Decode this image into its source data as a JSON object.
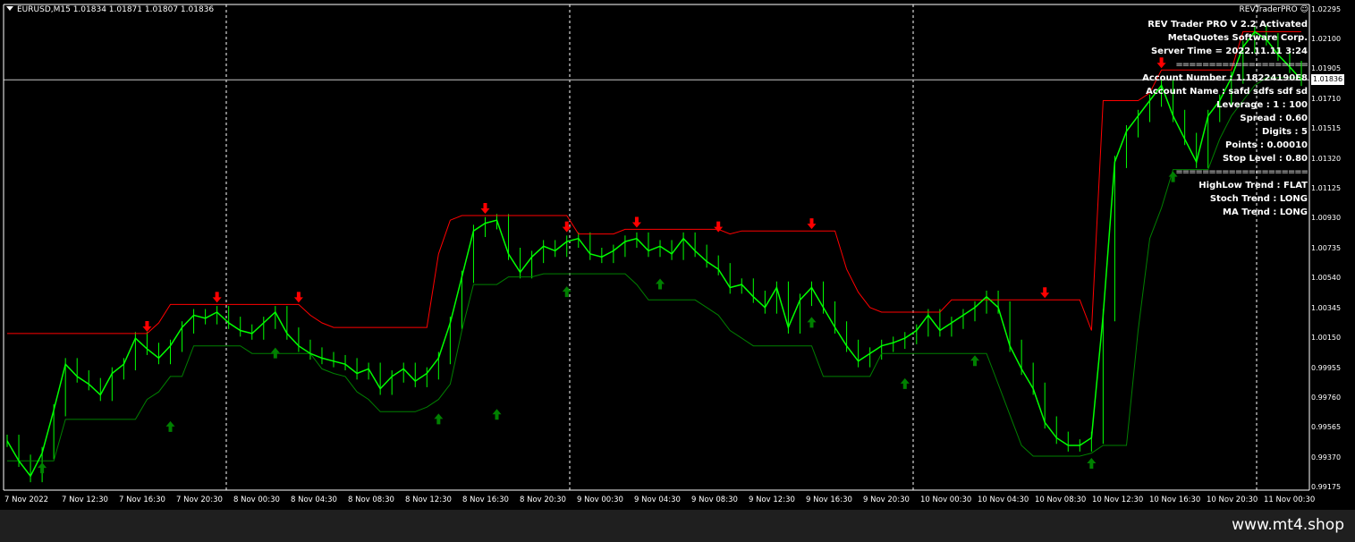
{
  "header": {
    "symbol_line": "EURUSD,M15  1.01834 1.01871 1.01807 1.01836"
  },
  "brand": {
    "label": "REVTraderPRO"
  },
  "info_panel": {
    "lines": [
      "REV Trader PRO V 2.2  Activated",
      "MetaQuotes Software Corp.",
      "Server Time = 2022.11.11 3:24",
      "====================",
      "Account Number : 1.18224190E8",
      "Account Name : safd   sdfs sdf  sd",
      "Leverage : 1 : 100",
      "Spread : 0.60",
      "Digits : 5",
      "Points : 0.00010",
      "Stop Level : 0.80",
      "====================",
      "HighLow Trend : FLAT",
      "Stoch Trend : LONG",
      "MA Trend : LONG"
    ]
  },
  "current_price": "1.01836",
  "footer": {
    "watermark": "www.mt4.shop"
  },
  "colors": {
    "candle": "#00ff00",
    "upper_band": "#ff0000",
    "lower_band": "#008000",
    "sell_arrow": "#ff0000",
    "buy_arrow": "#008000",
    "grid": "#ffffff",
    "background": "#000000"
  },
  "chart_data": {
    "type": "line",
    "symbol": "EURUSD",
    "timeframe": "M15",
    "ylim": [
      0.9917,
      1.0231
    ],
    "x_ticks": [
      "7 Nov 2022",
      "7 Nov 12:30",
      "7 Nov 16:30",
      "7 Nov 20:30",
      "8 Nov 00:30",
      "8 Nov 04:30",
      "8 Nov 08:30",
      "8 Nov 12:30",
      "8 Nov 16:30",
      "8 Nov 20:30",
      "9 Nov 00:30",
      "9 Nov 04:30",
      "9 Nov 08:30",
      "9 Nov 12:30",
      "9 Nov 16:30",
      "9 Nov 20:30",
      "10 Nov 00:30",
      "10 Nov 04:30",
      "10 Nov 08:30",
      "10 Nov 12:30",
      "10 Nov 16:30",
      "10 Nov 20:30",
      "11 Nov 00:30"
    ],
    "y_ticks": [
      "1.02295",
      "1.02100",
      "1.01905",
      "1.01710",
      "1.01515",
      "1.01320",
      "1.01125",
      "1.00930",
      "1.00735",
      "1.00540",
      "1.00345",
      "1.00150",
      "0.99955",
      "0.99760",
      "0.99565",
      "0.99370",
      "0.99175"
    ],
    "y_tick_values": [
      1.02295,
      1.021,
      1.01905,
      1.0171,
      1.01515,
      1.0132,
      1.01125,
      1.0093,
      1.00735,
      1.0054,
      1.00345,
      1.0015,
      0.99955,
      0.9976,
      0.99565,
      0.9937,
      0.99175
    ],
    "current_price_value": 1.01836,
    "day_separators": [
      "7 Nov 22:00",
      "8 Nov 22:00",
      "9 Nov 22:00",
      "10 Nov 22:00"
    ],
    "series": [
      {
        "name": "",
        "role": "price",
        "values": [
          0.9948,
          0.9935,
          0.9925,
          0.994,
          0.9968,
          0.9998,
          0.999,
          0.9985,
          0.9978,
          0.9992,
          0.9998,
          1.0015,
          1.0008,
          1.0002,
          1.001,
          1.0022,
          1.003,
          1.0028,
          1.0032,
          1.0025,
          1.002,
          1.0018,
          1.0025,
          1.0032,
          1.0018,
          1.001,
          1.0005,
          1.0002,
          1.0,
          0.9998,
          0.9992,
          0.9995,
          0.9982,
          0.999,
          0.9995,
          0.9987,
          0.9992,
          1.0002,
          1.0025,
          1.0055,
          1.0085,
          1.009,
          1.0092,
          1.007,
          1.0058,
          1.0068,
          1.0075,
          1.0072,
          1.0078,
          1.008,
          1.007,
          1.0068,
          1.0072,
          1.0078,
          1.008,
          1.0072,
          1.0075,
          1.007,
          1.008,
          1.0072,
          1.0065,
          1.006,
          1.0048,
          1.005,
          1.0042,
          1.0035,
          1.0048,
          1.0022,
          1.004,
          1.0048,
          1.0035,
          1.0022,
          1.001,
          1.0,
          1.0005,
          1.001,
          1.0012,
          1.0015,
          1.002,
          1.003,
          1.002,
          1.0025,
          1.003,
          1.0035,
          1.0042,
          1.0035,
          1.001,
          0.9995,
          0.9982,
          0.996,
          0.995,
          0.9945,
          0.9945,
          0.995,
          1.003,
          1.013,
          1.015,
          1.016,
          1.017,
          1.018,
          1.016,
          1.0145,
          1.013,
          1.016,
          1.017,
          1.0185,
          1.0205,
          1.0215,
          1.021,
          1.02,
          1.0192,
          1.01836
        ]
      },
      {
        "name": "",
        "role": "upper_band",
        "values": [
          1.0018,
          1.0018,
          1.0018,
          1.0018,
          1.0018,
          1.0018,
          1.0018,
          1.0018,
          1.0018,
          1.0018,
          1.0018,
          1.0018,
          1.0018,
          1.0025,
          1.0037,
          1.0037,
          1.0037,
          1.0037,
          1.0037,
          1.0037,
          1.0037,
          1.0037,
          1.0037,
          1.0037,
          1.0037,
          1.0037,
          1.003,
          1.0025,
          1.0022,
          1.0022,
          1.0022,
          1.0022,
          1.0022,
          1.0022,
          1.0022,
          1.0022,
          1.0022,
          1.007,
          1.0092,
          1.0095,
          1.0095,
          1.0095,
          1.0095,
          1.0095,
          1.0095,
          1.0095,
          1.0095,
          1.0095,
          1.0095,
          1.0083,
          1.0083,
          1.0083,
          1.0083,
          1.0086,
          1.0086,
          1.0086,
          1.0086,
          1.0086,
          1.0086,
          1.0086,
          1.0086,
          1.0086,
          1.0083,
          1.0085,
          1.0085,
          1.0085,
          1.0085,
          1.0085,
          1.0085,
          1.0085,
          1.0085,
          1.0085,
          1.006,
          1.0045,
          1.0035,
          1.0032,
          1.0032,
          1.0032,
          1.0032,
          1.0032,
          1.0032,
          1.004,
          1.004,
          1.004,
          1.004,
          1.004,
          1.004,
          1.004,
          1.004,
          1.004,
          1.004,
          1.004,
          1.004,
          1.002,
          1.017,
          1.017,
          1.017,
          1.017,
          1.0175,
          1.019,
          1.019,
          1.019,
          1.019,
          1.019,
          1.019,
          1.019,
          1.0215,
          1.0215,
          1.0215,
          1.0215,
          1.0215,
          1.0215
        ]
      },
      {
        "name": "",
        "role": "lower_band",
        "values": [
          0.9935,
          0.9935,
          0.9935,
          0.9935,
          0.9935,
          0.9962,
          0.9962,
          0.9962,
          0.9962,
          0.9962,
          0.9962,
          0.9962,
          0.9975,
          0.998,
          0.999,
          0.999,
          1.001,
          1.001,
          1.001,
          1.001,
          1.001,
          1.0005,
          1.0005,
          1.0005,
          1.0005,
          1.0005,
          1.0005,
          0.9995,
          0.9992,
          0.999,
          0.998,
          0.9975,
          0.9967,
          0.9967,
          0.9967,
          0.9967,
          0.997,
          0.9975,
          0.9985,
          1.002,
          1.005,
          1.005,
          1.005,
          1.0055,
          1.0055,
          1.0055,
          1.0057,
          1.0057,
          1.0057,
          1.0057,
          1.0057,
          1.0057,
          1.0057,
          1.0057,
          1.005,
          1.004,
          1.004,
          1.004,
          1.004,
          1.004,
          1.0035,
          1.003,
          1.002,
          1.0015,
          1.001,
          1.001,
          1.001,
          1.001,
          1.001,
          1.001,
          0.999,
          0.999,
          0.999,
          0.999,
          0.999,
          1.0005,
          1.0005,
          1.0005,
          1.0005,
          1.0005,
          1.0005,
          1.0005,
          1.0005,
          1.0005,
          1.0005,
          0.9985,
          0.9965,
          0.9945,
          0.9938,
          0.9938,
          0.9938,
          0.9938,
          0.9938,
          0.994,
          0.9945,
          0.9945,
          0.9945,
          1.002,
          1.008,
          1.01,
          1.0125,
          1.0125,
          1.0125,
          1.0125,
          1.0145,
          1.016,
          1.017,
          1.018,
          1.0185,
          1.0185,
          1.0185,
          1.0185
        ]
      }
    ],
    "sell_arrows": [
      {
        "index": 12,
        "value": 1.0018
      },
      {
        "index": 18,
        "value": 1.0037
      },
      {
        "index": 25,
        "value": 1.0037
      },
      {
        "index": 41,
        "value": 1.0095
      },
      {
        "index": 48,
        "value": 1.0083
      },
      {
        "index": 54,
        "value": 1.0086
      },
      {
        "index": 61,
        "value": 1.0083
      },
      {
        "index": 69,
        "value": 1.0085
      },
      {
        "index": 89,
        "value": 1.004
      },
      {
        "index": 99,
        "value": 1.019
      }
    ],
    "buy_arrows": [
      {
        "index": 3,
        "value": 0.9935
      },
      {
        "index": 14,
        "value": 0.9962
      },
      {
        "index": 23,
        "value": 1.001
      },
      {
        "index": 37,
        "value": 0.9967
      },
      {
        "index": 42,
        "value": 0.997
      },
      {
        "index": 48,
        "value": 1.005
      },
      {
        "index": 56,
        "value": 1.0055
      },
      {
        "index": 69,
        "value": 1.003
      },
      {
        "index": 77,
        "value": 0.999
      },
      {
        "index": 83,
        "value": 1.0005
      },
      {
        "index": 93,
        "value": 0.9938
      },
      {
        "index": 100,
        "value": 1.0125
      }
    ]
  }
}
